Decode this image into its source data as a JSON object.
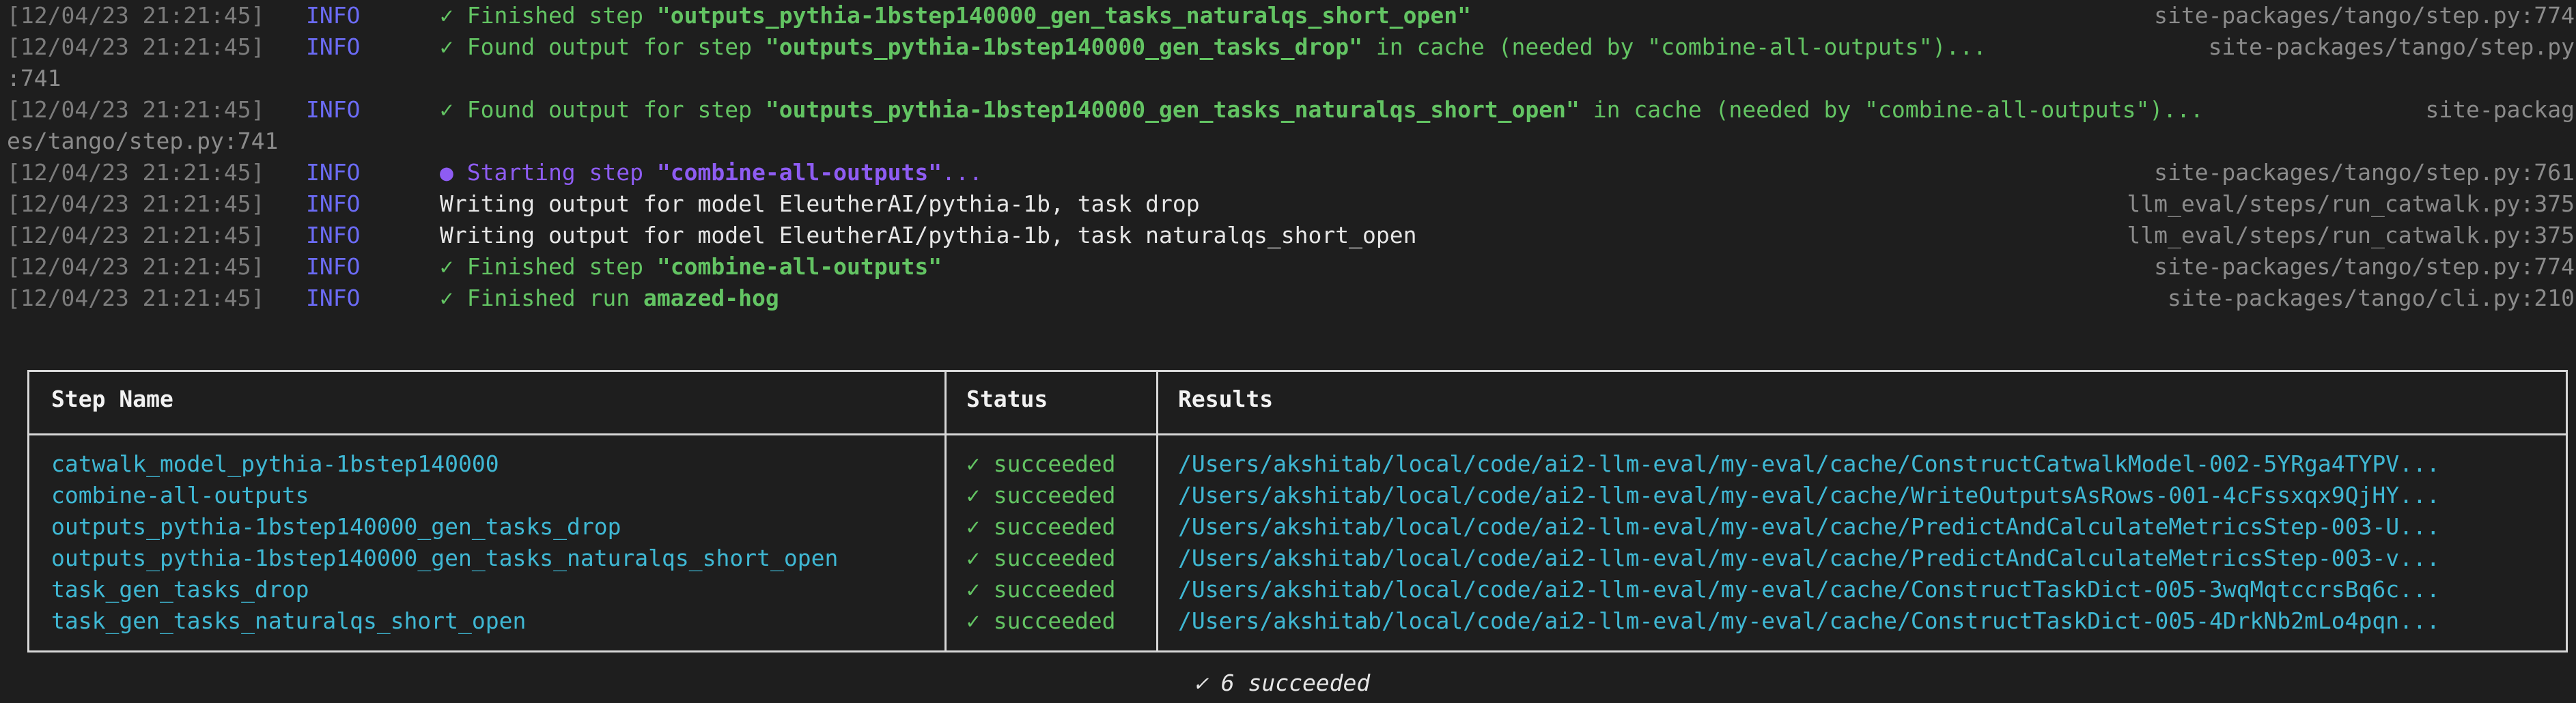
{
  "log_lines": [
    {
      "ts": "[12/04/23 21:21:45]",
      "lvl": "INFO",
      "pre": "✓ Finished step ",
      "bold": "\"outputs_pythia-1bstep140000_gen_tasks_naturalqs_short_open\"",
      "post": "",
      "src": "site-packages/tango/step.py:774"
    },
    {
      "ts": "[12/04/23 21:21:45]",
      "lvl": "INFO",
      "pre": "✓ Found output for step ",
      "bold": "\"outputs_pythia-1bstep140000_gen_tasks_drop\"",
      "post": " in cache (needed by \"combine-all-outputs\")...",
      "src": "site-packages/tango/step.py"
    },
    {
      "cont": ":741"
    },
    {
      "ts": "[12/04/23 21:21:45]",
      "lvl": "INFO",
      "pre": "✓ Found output for step ",
      "bold": "\"outputs_pythia-1bstep140000_gen_tasks_naturalqs_short_open\"",
      "post": " in cache (needed by \"combine-all-outputs\")...",
      "src": "site-packag"
    },
    {
      "cont": "es/tango/step.py:741"
    },
    {
      "ts": "[12/04/23 21:21:45]",
      "lvl": "INFO",
      "kind": "start",
      "pre": "● Starting step ",
      "bold": "\"combine-all-outputs\"",
      "post": "...",
      "src": "site-packages/tango/step.py:761"
    },
    {
      "ts": "[12/04/23 21:21:45]",
      "lvl": "INFO",
      "kind": "plain",
      "pre": "Writing output for model EleutherAI/pythia-1b, task drop",
      "bold": "",
      "post": "",
      "src": "llm_eval/steps/run_catwalk.py:375"
    },
    {
      "ts": "[12/04/23 21:21:45]",
      "lvl": "INFO",
      "kind": "plain",
      "pre": "Writing output for model EleutherAI/pythia-1b, task naturalqs_short_open",
      "bold": "",
      "post": "",
      "src": "llm_eval/steps/run_catwalk.py:375"
    },
    {
      "ts": "[12/04/23 21:21:45]",
      "lvl": "INFO",
      "pre": "✓ Finished step ",
      "bold": "\"combine-all-outputs\"",
      "post": "",
      "src": "site-packages/tango/step.py:774"
    },
    {
      "ts": "[12/04/23 21:21:45]",
      "lvl": "INFO",
      "pre": "✓ Finished run ",
      "bold": "amazed-hog",
      "post": "",
      "src": "site-packages/tango/cli.py:210"
    }
  ],
  "table": {
    "headers": {
      "step_name": "Step Name",
      "status": "Status",
      "results": "Results"
    },
    "rows": [
      {
        "step": "catwalk_model_pythia-1bstep140000",
        "status": "✓ succeeded",
        "result": "/Users/akshitab/local/code/ai2-llm-eval/my-eval/cache/ConstructCatwalkModel-002-5YRga4TYPV..."
      },
      {
        "step": "combine-all-outputs",
        "status": "✓ succeeded",
        "result": "/Users/akshitab/local/code/ai2-llm-eval/my-eval/cache/WriteOutputsAsRows-001-4cFssxqx9QjHY..."
      },
      {
        "step": "outputs_pythia-1bstep140000_gen_tasks_drop",
        "status": "✓ succeeded",
        "result": "/Users/akshitab/local/code/ai2-llm-eval/my-eval/cache/PredictAndCalculateMetricsStep-003-U..."
      },
      {
        "step": "outputs_pythia-1bstep140000_gen_tasks_naturalqs_short_open",
        "status": "✓ succeeded",
        "result": "/Users/akshitab/local/code/ai2-llm-eval/my-eval/cache/PredictAndCalculateMetricsStep-003-v..."
      },
      {
        "step": "task_gen_tasks_drop",
        "status": "✓ succeeded",
        "result": "/Users/akshitab/local/code/ai2-llm-eval/my-eval/cache/ConstructTaskDict-005-3wqMqtccrsBq6c..."
      },
      {
        "step": "task_gen_tasks_naturalqs_short_open",
        "status": "✓ succeeded",
        "result": "/Users/akshitab/local/code/ai2-llm-eval/my-eval/cache/ConstructTaskDict-005-4DrkNb2mLo4pqn..."
      }
    ]
  },
  "summary": "✓ 6 succeeded",
  "colors": {
    "background": "#1e1e1e",
    "info": "#6b6bf5",
    "success": "#63c463",
    "path": "#3fb8d4",
    "start": "#8e5cf3"
  }
}
